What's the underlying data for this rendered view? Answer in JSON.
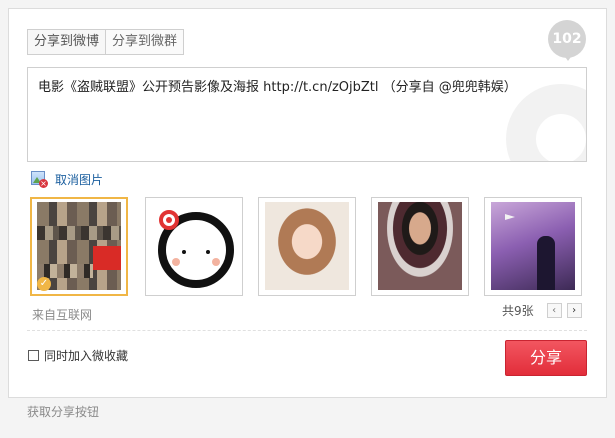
{
  "tabs": [
    {
      "label": "分享到微博",
      "active": true
    },
    {
      "label": "分享到微群",
      "active": false
    }
  ],
  "count_badge": "102",
  "share_text": "电影《盗贼联盟》公开预告影像及海报  http://t.cn/zOjbZtl  （分享自 @兜兜韩娱）",
  "cancel_image": {
    "label": "取消图片",
    "icon": "image-remove-icon"
  },
  "thumbnails": [
    {
      "name": "thumb-collage",
      "selected": true
    },
    {
      "name": "thumb-face-avatar",
      "selected": false
    },
    {
      "name": "thumb-portrait-1",
      "selected": false
    },
    {
      "name": "thumb-portrait-2",
      "selected": false
    },
    {
      "name": "thumb-silhouette",
      "selected": false
    }
  ],
  "source_label": "来自互联网",
  "pager": {
    "label": "共9张",
    "prev_icon": "‹",
    "next_icon": "›"
  },
  "favorites_checkbox": {
    "label": "同时加入微收藏",
    "checked": false
  },
  "share_button": "分享",
  "footer_link": "获取分享按钮",
  "colors": {
    "accent": "#e22d3a",
    "selected_border": "#f0b646",
    "link": "#1a5e9e"
  }
}
